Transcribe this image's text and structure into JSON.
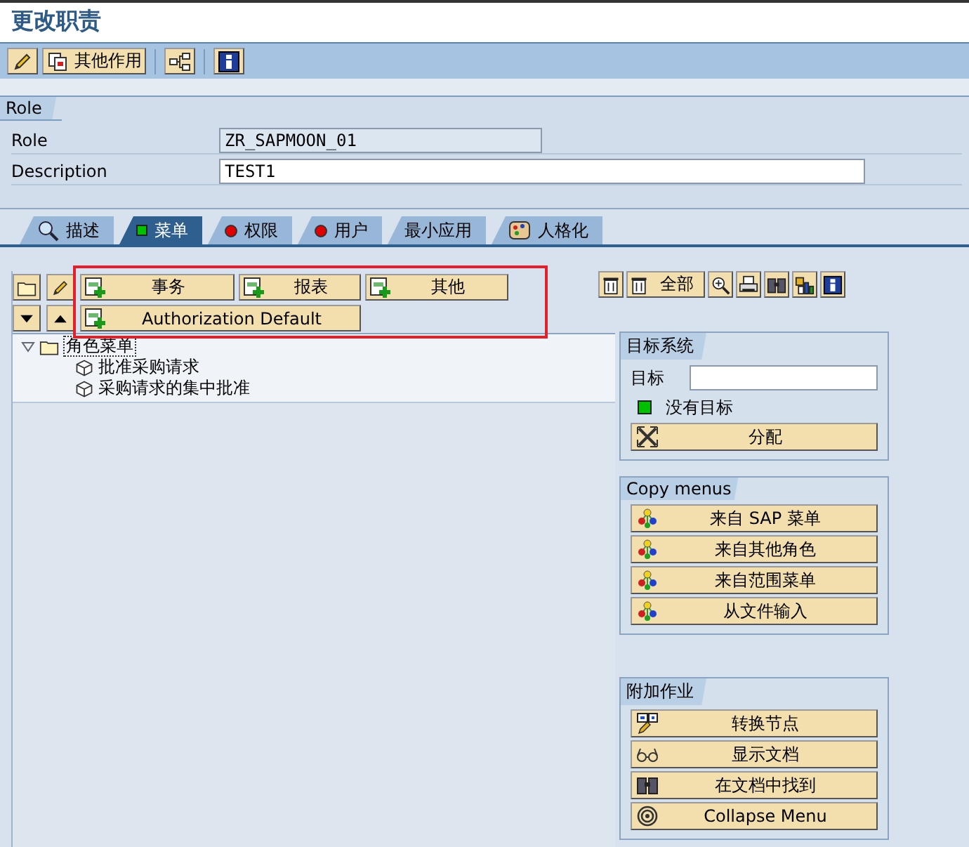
{
  "window": {
    "title": "更改职责"
  },
  "toolbar": [
    [
      {
        "kind": "edit"
      },
      {
        "kind": "roles",
        "label": "其他作用"
      }
    ],
    [
      {
        "kind": "hierarchy"
      }
    ],
    [
      {
        "kind": "info"
      }
    ]
  ],
  "role_group": {
    "title": "Role",
    "fields": [
      {
        "label": "Role",
        "value": "ZR_SAPMOON_01",
        "disabled": true
      },
      {
        "label": "Description",
        "value": "TEST1",
        "disabled": false
      }
    ]
  },
  "tabs": [
    {
      "kind": "search",
      "label": "描述",
      "selected": false
    },
    {
      "kind": "light",
      "color": "#00c000",
      "label": "菜单",
      "selected": true
    },
    {
      "kind": "light",
      "color": "#e00000",
      "label": "权限",
      "selected": false
    },
    {
      "kind": "light",
      "color": "#e00000",
      "label": "用户",
      "selected": false
    },
    {
      "kind": "plain",
      "label": "最小应用",
      "selected": false
    },
    {
      "kind": "palette",
      "label": "人格化",
      "selected": false
    }
  ],
  "menu_tools": {
    "left": [
      {
        "kind": "folder"
      },
      {
        "kind": "edit"
      },
      {
        "kind": "down"
      },
      {
        "kind": "up"
      }
    ],
    "add_buttons": [
      {
        "label": "事务"
      },
      {
        "label": "报表"
      },
      {
        "label": "其他"
      },
      {
        "label": "Authorization Default"
      }
    ],
    "right": [
      {
        "kind": "delete"
      },
      {
        "kind": "delete",
        "label": "全部"
      },
      {
        "kind": "zoom"
      },
      {
        "kind": "print"
      },
      {
        "kind": "find"
      },
      {
        "kind": "chart"
      },
      {
        "kind": "info"
      }
    ]
  },
  "tree": [
    {
      "label": "角色菜单",
      "expanded": true,
      "children": [
        {
          "label": "批准采购请求"
        },
        {
          "label": "采购请求的集中批准"
        }
      ]
    }
  ],
  "target_system": {
    "title": "目标系统",
    "field_label": "目标",
    "status": {
      "text": "没有目标",
      "color": "#00c000"
    },
    "button": {
      "kind": "assign",
      "label": "分配"
    }
  },
  "copy_menus": {
    "title": "Copy menus",
    "buttons": [
      {
        "kind": "copy",
        "label": "来自 SAP 菜单"
      },
      {
        "kind": "copy",
        "label": "来自其他角色"
      },
      {
        "kind": "copy",
        "label": "来自范围菜单"
      },
      {
        "kind": "copy",
        "label": "从文件输入"
      }
    ]
  },
  "additional": {
    "title": "附加作业",
    "buttons": [
      {
        "kind": "convert",
        "label": "转换节点"
      },
      {
        "kind": "glasses",
        "label": "显示文档"
      },
      {
        "kind": "find",
        "label": "在文档中找到"
      },
      {
        "kind": "spiral",
        "label": "Collapse Menu"
      }
    ]
  }
}
